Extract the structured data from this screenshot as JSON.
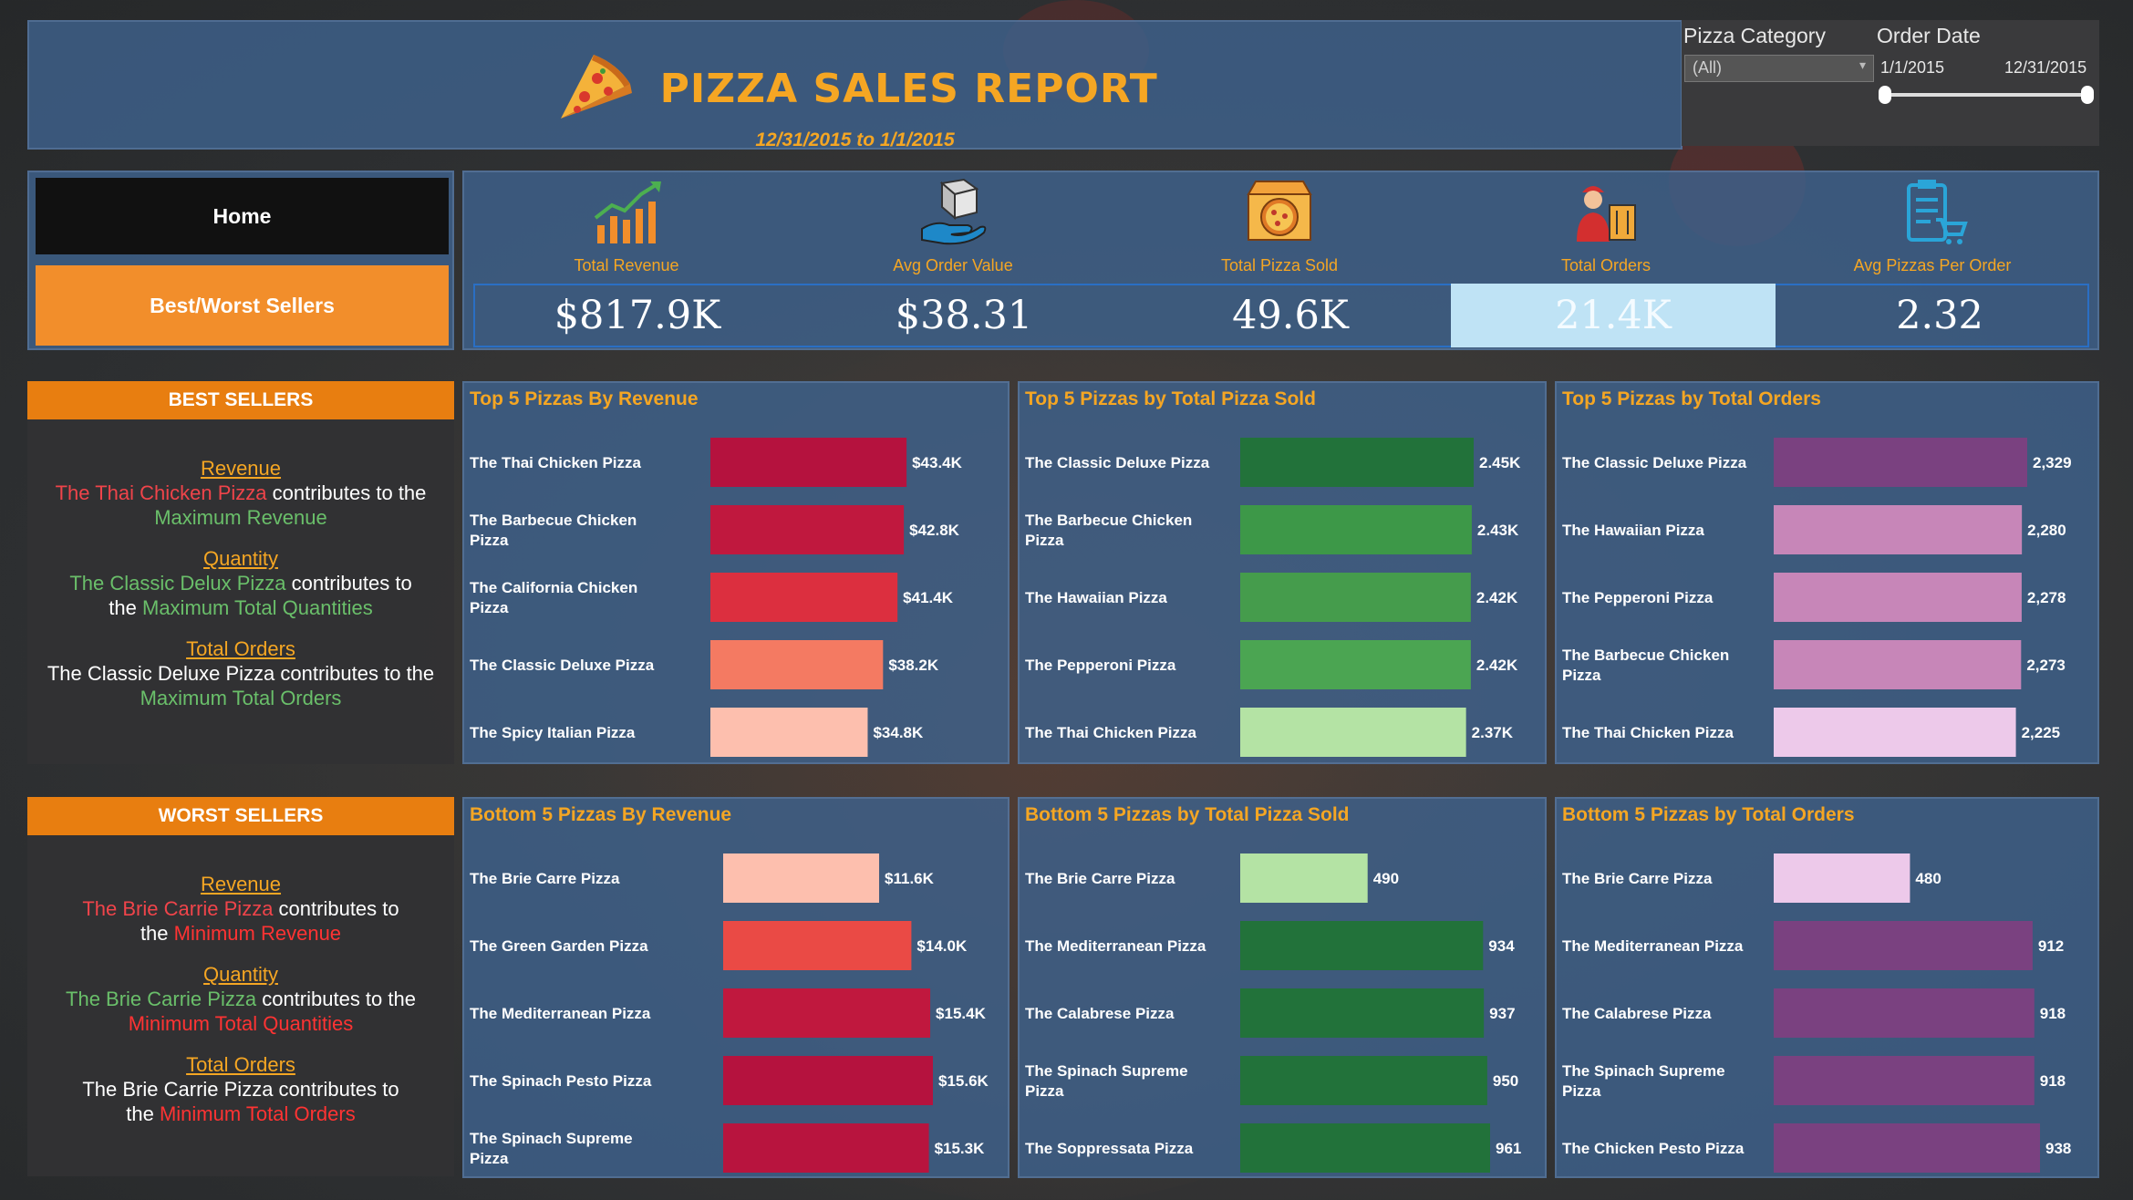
{
  "header": {
    "title": "PIZZA SALES REPORT",
    "date_range": "12/31/2015 to 1/1/2015"
  },
  "filters": {
    "category_label": "Pizza Category",
    "category_value": "(All)",
    "date_label": "Order Date",
    "date_start": "1/1/2015",
    "date_end": "12/31/2015"
  },
  "nav": {
    "home": "Home",
    "best_worst": "Best/Worst Sellers"
  },
  "kpis": [
    {
      "label": "Total Revenue",
      "value": "$817.9K",
      "icon": "revenue-chart-icon"
    },
    {
      "label": "Avg Order Value",
      "value": "$38.31",
      "icon": "hand-box-icon"
    },
    {
      "label": "Total Pizza Sold",
      "value": "49.6K",
      "icon": "pizza-box-icon"
    },
    {
      "label": "Total Orders",
      "value": "21.4K",
      "icon": "delivery-person-icon"
    },
    {
      "label": "Avg Pizzas Per Order",
      "value": "2.32",
      "icon": "clipboard-cart-icon"
    }
  ],
  "best": {
    "heading": "BEST SELLERS",
    "revenue_title": "Revenue",
    "revenue_pizza": "The Thai Chicken Pizza",
    "revenue_mid": " contributes to the",
    "revenue_tail": "Maximum Revenue",
    "quantity_title": "Quantity",
    "quantity_pizza": "The Classic Delux Pizza",
    "quantity_mid": " contributes to",
    "quantity_the": "the ",
    "quantity_tail": "Maximum Total Quantities",
    "orders_title": "Total Orders",
    "orders_pizza": "The Classic Deluxe Pizza",
    "orders_mid": " contributes to the",
    "orders_tail": "Maximum Total Orders"
  },
  "worst": {
    "heading": "WORST SELLERS",
    "revenue_title": "Revenue",
    "revenue_pizza": "The Brie Carrie Pizza",
    "revenue_mid": " contributes to",
    "revenue_the": "the ",
    "revenue_tail": "Minimum Revenue",
    "quantity_title": "Quantity",
    "quantity_pizza": "The Brie Carrie Pizza",
    "quantity_mid": " contributes to the",
    "quantity_tail": "Minimum Total Quantities",
    "orders_title": "Total Orders",
    "orders_pizza": "The Brie Carrie Pizza",
    "orders_mid": " contributes to",
    "orders_the": "the ",
    "orders_tail": "Minimum Total Orders"
  },
  "colors": {
    "accent": "#f5a623",
    "panel": "#3e628c",
    "orange_button": "#f28e2b"
  },
  "chart_data": [
    {
      "id": "top-rev",
      "type": "bar",
      "title": "Top 5 Pizzas By Revenue",
      "categories": [
        "The Thai Chicken Pizza",
        "The Barbecue Chicken Pizza",
        "The California Chicken Pizza",
        "The Classic Deluxe Pizza",
        "The Spicy Italian Pizza"
      ],
      "values": [
        43.4,
        42.8,
        41.4,
        38.2,
        34.8
      ],
      "labels": [
        "$43.4K",
        "$42.8K",
        "$41.4K",
        "$38.2K",
        "$34.8K"
      ],
      "colors": [
        "#b5123e",
        "#c0183e",
        "#dc2f3f",
        "#f47a62",
        "#fdbfae"
      ],
      "xlim": [
        0,
        45.6
      ]
    },
    {
      "id": "top-sold",
      "type": "bar",
      "title": "Top 5 Pizzas by Total Pizza Sold",
      "categories": [
        "The Classic Deluxe Pizza",
        "The Barbecue Chicken Pizza",
        "The Hawaiian Pizza",
        "The Pepperoni Pizza",
        "The Thai Chicken Pizza"
      ],
      "values": [
        2.45,
        2.43,
        2.42,
        2.42,
        2.37
      ],
      "labels": [
        "2.45K",
        "2.43K",
        "2.42K",
        "2.42K",
        "2.37K"
      ],
      "colors": [
        "#22723a",
        "#3d9848",
        "#459c4c",
        "#4ba552",
        "#b4e3a4"
      ],
      "xlim": [
        0,
        2.45
      ]
    },
    {
      "id": "top-orders",
      "type": "bar",
      "title": "Top 5 Pizzas by Total Orders",
      "categories": [
        "The Classic Deluxe Pizza",
        "The Hawaiian Pizza",
        "The Pepperoni Pizza",
        "The Barbecue Chicken Pizza",
        "The Thai Chicken Pizza"
      ],
      "values": [
        2329,
        2280,
        2278,
        2273,
        2225
      ],
      "labels": [
        "2,329",
        "2,280",
        "2,278",
        "2,273",
        "2,225"
      ],
      "colors": [
        "#7a4180",
        "#c786b8",
        "#c786b8",
        "#c786b8",
        "#edc9ea"
      ],
      "xlim": [
        0,
        2329
      ]
    },
    {
      "id": "bot-rev",
      "type": "bar",
      "title": "Bottom 5 Pizzas By Revenue",
      "categories": [
        "The Brie Carre Pizza",
        "The Green Garden Pizza",
        "The Mediterranean Pizza",
        "The Spinach Pesto Pizza",
        "The Spinach Supreme Pizza"
      ],
      "values": [
        11.6,
        14.0,
        15.4,
        15.6,
        15.3
      ],
      "labels": [
        "$11.6K",
        "$14.0K",
        "$15.4K",
        "$15.6K",
        "$15.3K"
      ],
      "colors": [
        "#fdbfae",
        "#ea4a45",
        "#c0183e",
        "#b5123e",
        "#b8143e"
      ],
      "xlim": [
        0,
        15.6
      ]
    },
    {
      "id": "bot-sold",
      "type": "bar",
      "title": "Bottom 5 Pizzas by Total Pizza Sold",
      "categories": [
        "The Brie Carre Pizza",
        "The Mediterranean Pizza",
        "The Calabrese Pizza",
        "The Spinach Supreme Pizza",
        "The Soppressata Pizza"
      ],
      "values": [
        490,
        934,
        937,
        950,
        961
      ],
      "labels": [
        "490",
        "934",
        "937",
        "950",
        "961"
      ],
      "colors": [
        "#b4e3a4",
        "#22723a",
        "#22723a",
        "#22723a",
        "#22723a"
      ],
      "xlim": [
        0,
        961
      ]
    },
    {
      "id": "bot-orders",
      "type": "bar",
      "title": "Bottom 5 Pizzas by Total Orders",
      "categories": [
        "The Brie Carre Pizza",
        "The Mediterranean Pizza",
        "The Calabrese Pizza",
        "The Spinach Supreme Pizza",
        "The Chicken Pesto Pizza"
      ],
      "values": [
        480,
        912,
        918,
        918,
        938
      ],
      "labels": [
        "480",
        "912",
        "918",
        "918",
        "938"
      ],
      "colors": [
        "#edc9ea",
        "#7a4180",
        "#7a4180",
        "#7a4180",
        "#7a4180"
      ],
      "xlim": [
        0,
        938
      ]
    }
  ]
}
